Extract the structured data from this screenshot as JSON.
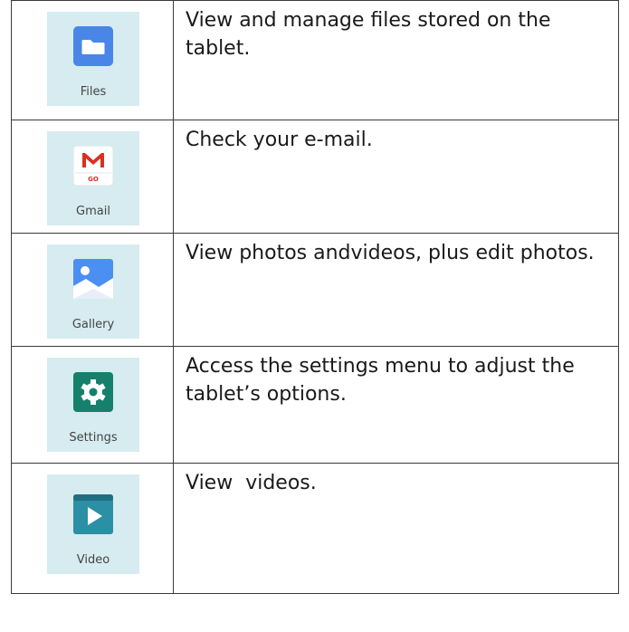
{
  "rows": [
    {
      "app": "Files",
      "icon": "folder-icon",
      "description": "View and manage files stored on the tablet."
    },
    {
      "app": "Gmail",
      "icon": "gmail-icon",
      "badge": "GO",
      "description": "Check your e-mail."
    },
    {
      "app": "Gallery",
      "icon": "gallery-icon",
      "description": "View photos andvideos, plus edit photos."
    },
    {
      "app": "Settings",
      "icon": "gear-icon",
      "description": "Access the settings menu to adjust the tablet’s options."
    },
    {
      "app": "Video",
      "icon": "video-icon",
      "description": "View  videos."
    }
  ],
  "colors": {
    "tile_bg": "#d6ecf0",
    "files_blue": "#4a86e8",
    "gmail_red": "#d93025",
    "gallery_blue": "#4b8ff2",
    "settings_green": "#17806d",
    "video_teal": "#2b8fa6"
  }
}
